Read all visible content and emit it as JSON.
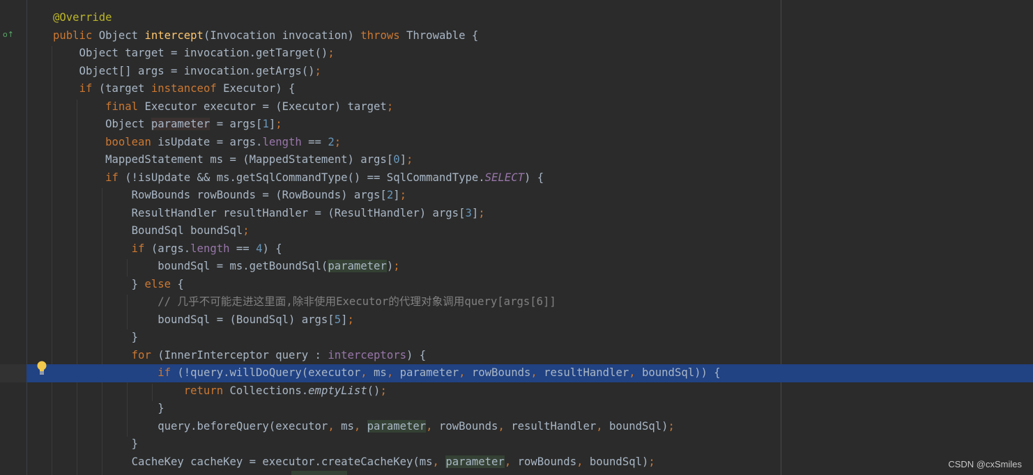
{
  "editor": {
    "colors": {
      "background": "#2b2b2b",
      "current_line": "#214283",
      "keyword": "#cc7832",
      "annotation": "#bbb529",
      "method_decl": "#ffc66d",
      "number": "#6897bb",
      "field": "#9876aa",
      "comment": "#808080",
      "text": "#a9b7c6"
    },
    "gutter_icons": {
      "override_marker": "override-up-arrow-icon",
      "intention_bulb": "lightbulb-icon"
    }
  },
  "watermark": "CSDN @cxSmiles"
}
